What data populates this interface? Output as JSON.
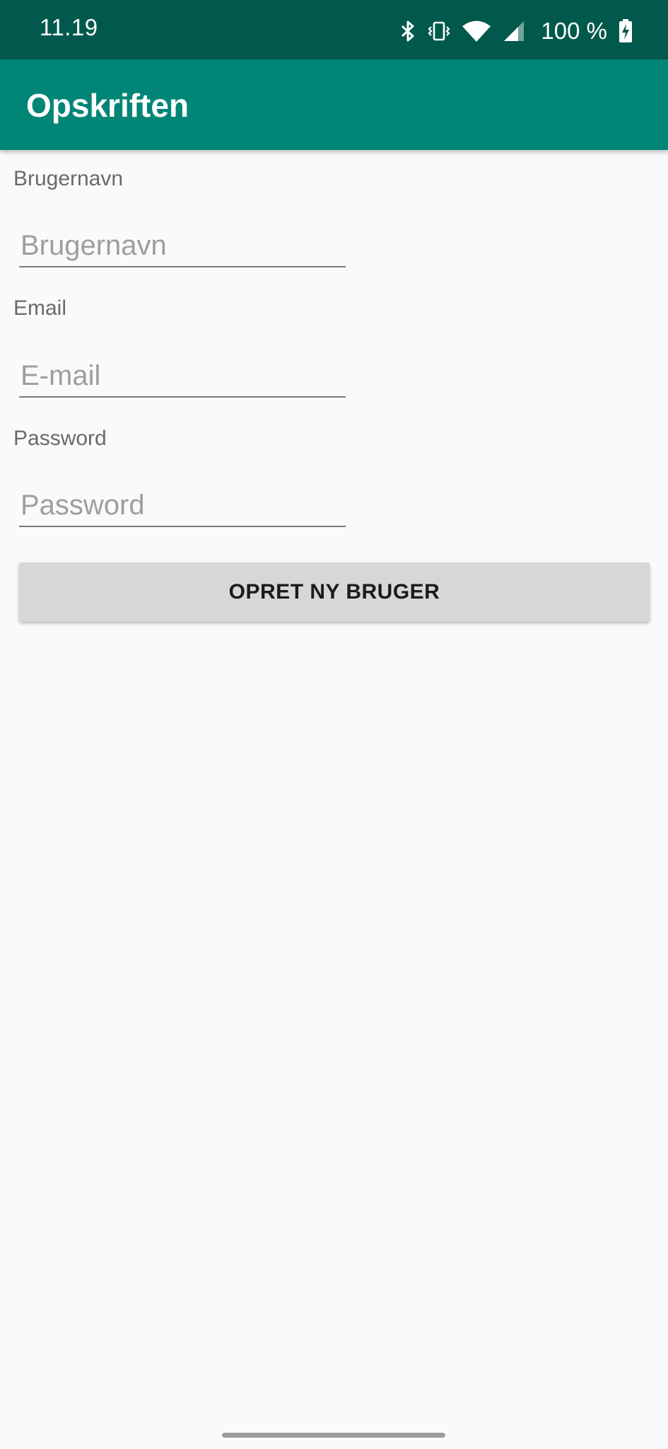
{
  "status_bar": {
    "time": "11.19",
    "battery": "100 %",
    "icons": [
      "bluetooth-icon",
      "vibrate-icon",
      "wifi-icon",
      "cellular-signal-icon",
      "battery-charging-icon"
    ]
  },
  "app_bar": {
    "title": "Opskriften"
  },
  "form": {
    "username": {
      "label": "Brugernavn",
      "placeholder": "Brugernavn",
      "value": ""
    },
    "email": {
      "label": "Email",
      "placeholder": "E-mail",
      "value": ""
    },
    "password": {
      "label": "Password",
      "placeholder": "Password",
      "value": ""
    },
    "submit_label": "OPRET NY BRUGER"
  },
  "colors": {
    "status_bar": "#00594c",
    "app_bar": "#008576",
    "background": "#fafafa",
    "button": "#d6d7d7"
  }
}
